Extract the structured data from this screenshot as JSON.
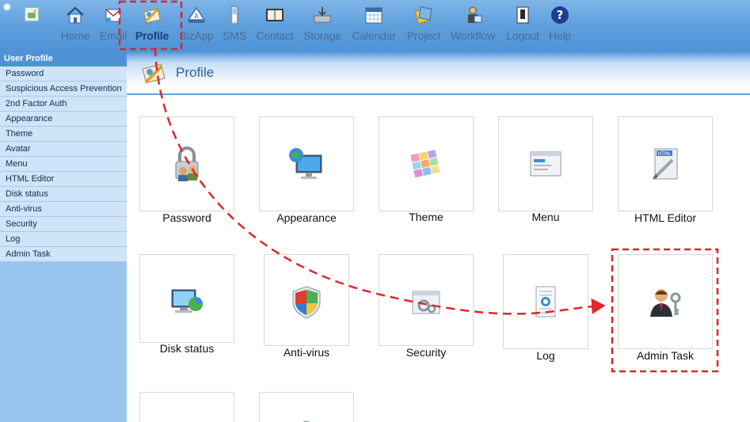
{
  "toolbar": {
    "items": [
      {
        "id": "home",
        "label": "Home",
        "icon": "home-icon"
      },
      {
        "id": "email",
        "label": "Email",
        "icon": "email-icon"
      },
      {
        "id": "profile",
        "label": "Profile",
        "icon": "profile-icon",
        "active": true
      },
      {
        "id": "bizapp",
        "label": "BizApp",
        "icon": "bizapp-icon"
      },
      {
        "id": "sms",
        "label": "SMS",
        "icon": "phone-icon"
      },
      {
        "id": "contact",
        "label": "Contact",
        "icon": "contact-book-icon"
      },
      {
        "id": "storage",
        "label": "Storage",
        "icon": "storage-icon"
      },
      {
        "id": "calendar",
        "label": "Calendar",
        "icon": "calendar-icon"
      },
      {
        "id": "project",
        "label": "Project",
        "icon": "project-icon"
      },
      {
        "id": "workflow",
        "label": "Workflow",
        "icon": "workflow-icon"
      },
      {
        "id": "logout",
        "label": "Logout",
        "icon": "logout-icon"
      },
      {
        "id": "help",
        "label": "Help",
        "icon": "help-icon"
      }
    ]
  },
  "sidebar": {
    "title": "User Profile",
    "items": [
      "Password",
      "Suspicious Access Prevention",
      "2nd Factor Auth",
      "Appearance",
      "Theme",
      "Avatar",
      "Menu",
      "HTML Editor",
      "Disk status",
      "Anti-virus",
      "Security",
      "Log",
      "Admin Task"
    ]
  },
  "main": {
    "title": "Profile",
    "tiles": [
      {
        "label": "Password",
        "icon": "padlock-users-icon"
      },
      {
        "label": "Appearance",
        "icon": "monitor-globe-icon"
      },
      {
        "label": "Theme",
        "icon": "color-palette-icon"
      },
      {
        "label": "Menu",
        "icon": "window-menu-icon"
      },
      {
        "label": "HTML Editor",
        "icon": "html-editor-icon"
      },
      {
        "label": "Disk status",
        "icon": "disk-chart-icon"
      },
      {
        "label": "Anti-virus",
        "icon": "shield-icon"
      },
      {
        "label": "Security",
        "icon": "security-gear-icon"
      },
      {
        "label": "Log",
        "icon": "log-document-icon"
      },
      {
        "label": "Admin Task",
        "icon": "admin-keys-icon"
      }
    ]
  },
  "colors": {
    "toolbar": "#5f9fdc",
    "sidebar": "#98c4ee",
    "annotation": "#e0252b"
  }
}
